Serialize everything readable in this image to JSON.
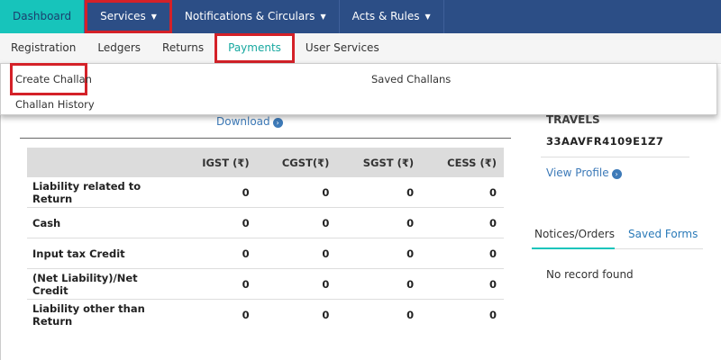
{
  "topnav": {
    "items": [
      {
        "label": "Dashboard",
        "has_caret": false
      },
      {
        "label": "Services",
        "has_caret": true
      },
      {
        "label": "Notifications & Circulars",
        "has_caret": true
      },
      {
        "label": "Acts & Rules",
        "has_caret": true
      }
    ]
  },
  "submenu": {
    "items": [
      "Registration",
      "Ledgers",
      "Returns",
      "Payments",
      "User Services"
    ]
  },
  "dropdown": {
    "create_challan": "Create Challan",
    "saved_challans": "Saved Challans",
    "challan_history": "Challan History"
  },
  "ledger": {
    "download_label": "Download",
    "columns": [
      "",
      "IGST (₹)",
      "CGST(₹)",
      "SGST (₹)",
      "CESS (₹)"
    ],
    "rows": [
      {
        "label": "Liability related to Return",
        "values": [
          "0",
          "0",
          "0",
          "0"
        ]
      },
      {
        "label": "Cash",
        "values": [
          "0",
          "0",
          "0",
          "0"
        ]
      },
      {
        "label": "Input tax Credit",
        "values": [
          "0",
          "0",
          "0",
          "0"
        ]
      },
      {
        "label": "(Net Liability)/Net Credit",
        "values": [
          "0",
          "0",
          "0",
          "0"
        ]
      },
      {
        "label": "Liability other than Return",
        "values": [
          "0",
          "0",
          "0",
          "0"
        ]
      }
    ]
  },
  "profile": {
    "name_fragment": "TRAVELS",
    "gstin": "33AAVFR4109E1Z7",
    "view_profile": "View Profile"
  },
  "right_tabs": {
    "notices": "Notices/Orders",
    "saved_forms": "Saved Forms",
    "no_record": "No record found"
  },
  "colors": {
    "nav_bg": "#2c4e86",
    "active_tab": "#17c4bb",
    "highlight_box": "#d42128",
    "link": "#3d7ab8"
  }
}
